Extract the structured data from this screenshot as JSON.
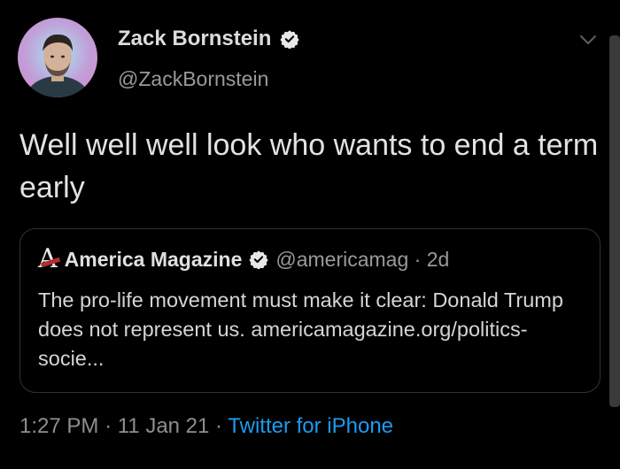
{
  "tweet": {
    "author": {
      "name": "Zack Bornstein",
      "handle": "@ZackBornstein",
      "verified": true,
      "avatar_icon": "profile-photo"
    },
    "text": "Well well well look who wants to end a term early",
    "quoted": {
      "logo_letter": "A",
      "name": "America Magazine",
      "verified": true,
      "handle": "@americamag",
      "separator": "·",
      "age": "2d",
      "text": "The pro-life movement must make it clear: Donald Trump does not represent us.",
      "link": "americamagazine.org/politics-socie..."
    },
    "time": "1:27 PM",
    "date": "11 Jan 21",
    "separator": "·",
    "source": "Twitter for iPhone"
  },
  "colors": {
    "background": "#000000",
    "link": "#1d9bf0",
    "verified": "#e8e8e8",
    "logo_accent": "#b22d2d"
  },
  "icons": {
    "verified": "verified-badge-icon",
    "menu": "chevron-down-icon"
  }
}
